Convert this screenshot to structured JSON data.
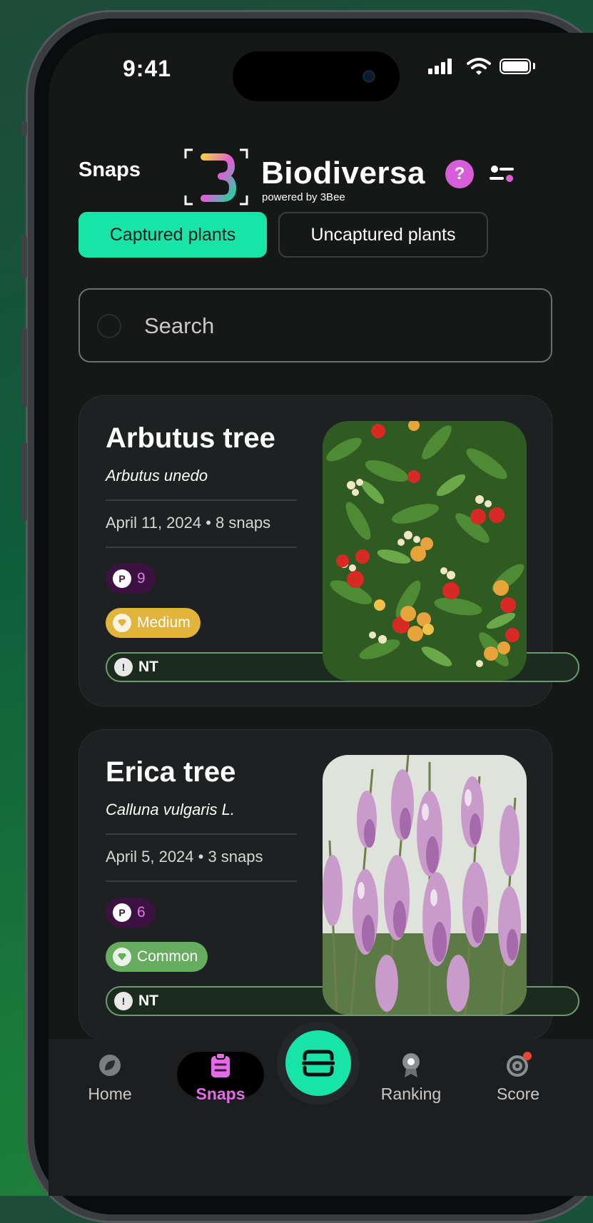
{
  "status_bar": {
    "time": "9:41"
  },
  "header": {
    "title": "Snaps",
    "brand": "Biodiversa",
    "brand_sub": "powered by 3Bee",
    "help_label": "?"
  },
  "tabs": [
    {
      "label": "Captured plants",
      "active": true
    },
    {
      "label": "Uncaptured plants",
      "active": false
    }
  ],
  "search": {
    "placeholder": "Search",
    "value": ""
  },
  "plants": [
    {
      "name": "Arbutus tree",
      "scientific": "Arbutus unedo",
      "meta": "April 11, 2024  •  8 snaps",
      "points": "9",
      "rarity": "Medium",
      "rarity_color": "#e3b43c",
      "conservation": "NT"
    },
    {
      "name": "Erica tree",
      "scientific": "Calluna vulgaris L.",
      "meta": "April 5, 2024  •  3 snaps",
      "points": "6",
      "rarity": "Common",
      "rarity_color": "#66ad5f",
      "conservation": "NT"
    }
  ],
  "nav": {
    "items": [
      {
        "label": "Home",
        "icon": "leaf-icon"
      },
      {
        "label": "Snaps",
        "icon": "clipboard-icon",
        "active": true
      },
      {
        "label": "",
        "icon": "scan-icon"
      },
      {
        "label": "Ranking",
        "icon": "medal-icon"
      },
      {
        "label": "Score",
        "icon": "score-icon"
      }
    ],
    "accent": "#18e4a7",
    "snaps_color": "#e46be8"
  }
}
